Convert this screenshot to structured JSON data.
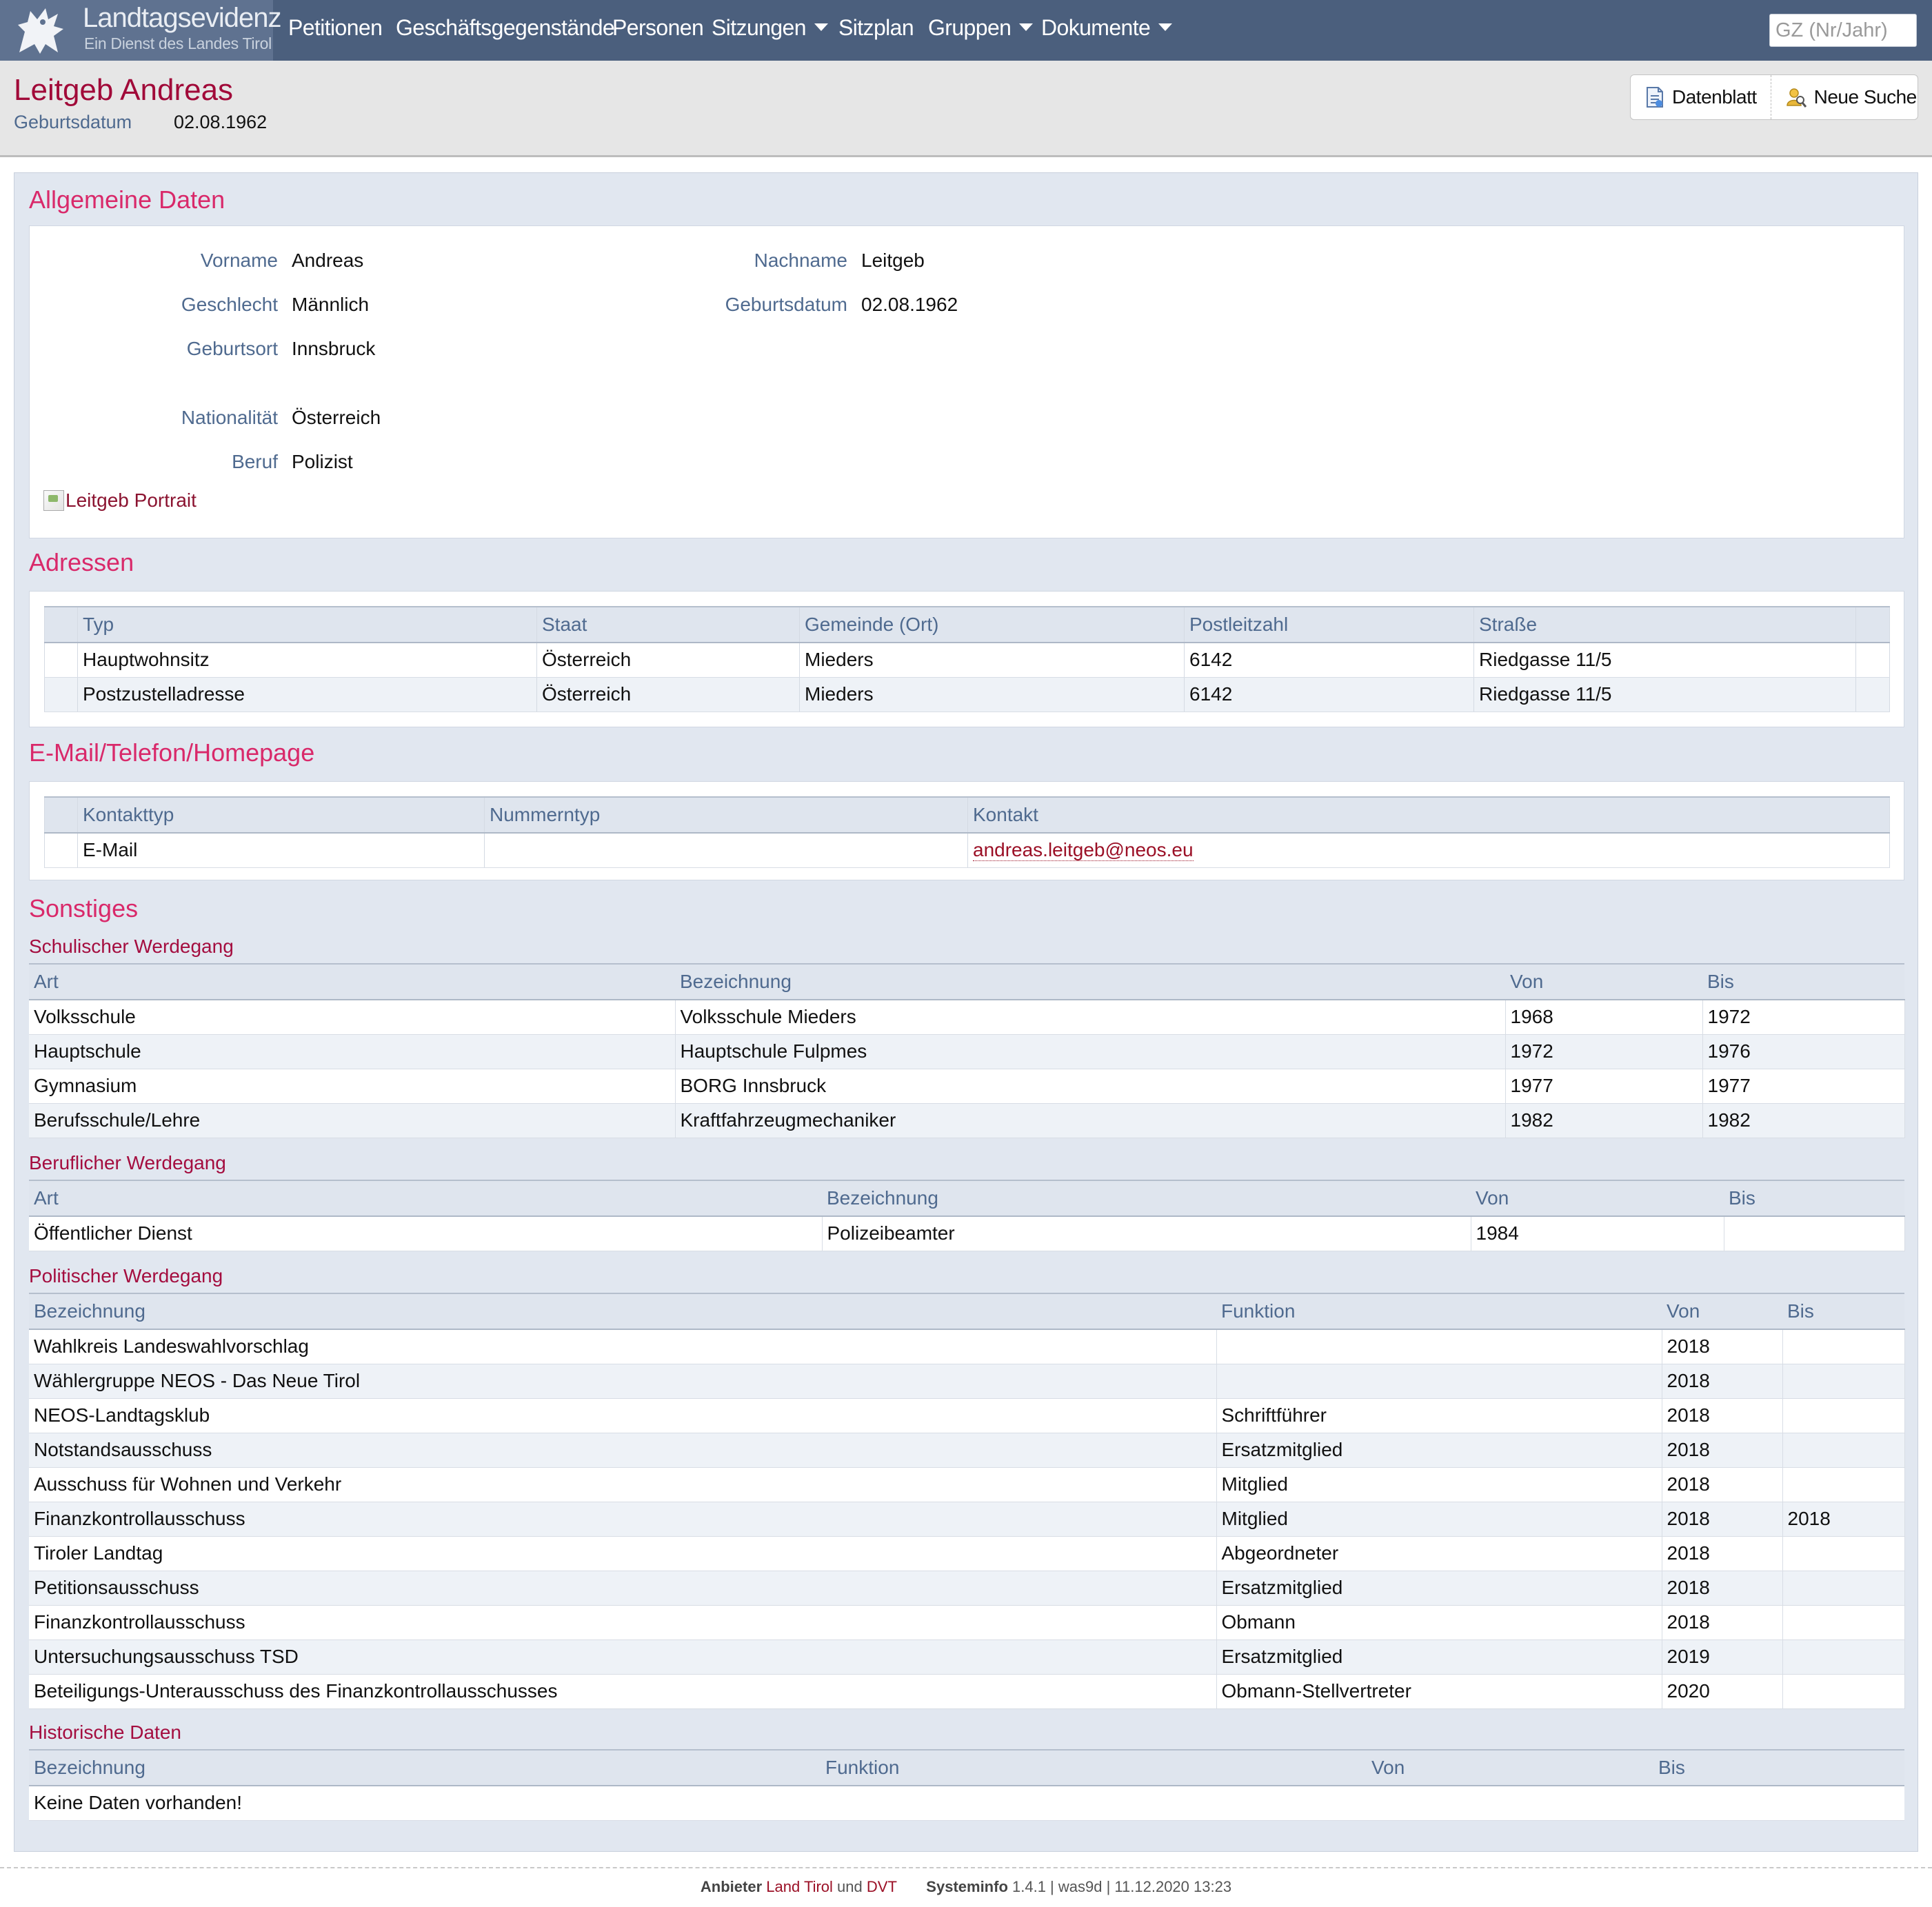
{
  "brand": {
    "title": "Landtagsevidenz",
    "subtitle": "Ein Dienst des Landes Tirol"
  },
  "nav": {
    "items": [
      {
        "label": "Petitionen",
        "dropdown": false
      },
      {
        "label": "Geschäftsgegenstände",
        "dropdown": false
      },
      {
        "label": "Personen",
        "dropdown": false
      },
      {
        "label": "Sitzungen",
        "dropdown": true
      },
      {
        "label": "Sitzplan",
        "dropdown": false
      },
      {
        "label": "Gruppen",
        "dropdown": true
      },
      {
        "label": "Dokumente",
        "dropdown": true
      }
    ],
    "search_placeholder": "GZ (Nr/Jahr)"
  },
  "header": {
    "name": "Leitgeb Andreas",
    "birth_label": "Geburtsdatum",
    "birth_value": "02.08.1962",
    "btn_datenblatt": "Datenblatt",
    "btn_neue_suche": "Neue Suche"
  },
  "allgemein": {
    "title": "Allgemeine Daten",
    "vorname_label": "Vorname",
    "vorname": "Andreas",
    "nachname_label": "Nachname",
    "nachname": "Leitgeb",
    "geschlecht_label": "Geschlecht",
    "geschlecht": "Männlich",
    "geburtsdatum_label": "Geburtsdatum",
    "geburtsdatum": "02.08.1962",
    "geburtsort_label": "Geburtsort",
    "geburtsort": "Innsbruck",
    "nationalitaet_label": "Nationalität",
    "nationalitaet": "Österreich",
    "beruf_label": "Beruf",
    "beruf": "Polizist",
    "portrait_alt": "Leitgeb Portrait"
  },
  "adressen": {
    "title": "Adressen",
    "headers": [
      "Typ",
      "Staat",
      "Gemeinde (Ort)",
      "Postleitzahl",
      "Straße"
    ],
    "rows": [
      [
        "Hauptwohnsitz",
        "Österreich",
        "Mieders",
        "6142",
        "Riedgasse 11/5"
      ],
      [
        "Postzustelladresse",
        "Österreich",
        "Mieders",
        "6142",
        "Riedgasse 11/5"
      ]
    ]
  },
  "kontakt": {
    "title": "E-Mail/Telefon/Homepage",
    "headers": [
      "Kontakttyp",
      "Nummerntyp",
      "Kontakt"
    ],
    "rows": [
      [
        "E-Mail",
        "",
        "andreas.leitgeb@neos.eu"
      ]
    ]
  },
  "sonstiges": {
    "title": "Sonstiges",
    "schulisch": {
      "title": "Schulischer Werdegang",
      "headers": [
        "Art",
        "Bezeichnung",
        "Von",
        "Bis"
      ],
      "rows": [
        [
          "Volksschule",
          "Volksschule Mieders",
          "1968",
          "1972"
        ],
        [
          "Hauptschule",
          "Hauptschule Fulpmes",
          "1972",
          "1976"
        ],
        [
          "Gymnasium",
          "BORG Innsbruck",
          "1977",
          "1977"
        ],
        [
          "Berufsschule/Lehre",
          "Kraftfahrzeugmechaniker",
          "1982",
          "1982"
        ]
      ]
    },
    "beruflich": {
      "title": "Beruflicher Werdegang",
      "headers": [
        "Art",
        "Bezeichnung",
        "Von",
        "Bis"
      ],
      "rows": [
        [
          "Öffentlicher Dienst",
          "Polizeibeamter",
          "1984",
          ""
        ]
      ]
    },
    "politisch": {
      "title": "Politischer Werdegang",
      "headers": [
        "Bezeichnung",
        "Funktion",
        "Von",
        "Bis"
      ],
      "rows": [
        [
          "Wahlkreis Landeswahlvorschlag",
          "",
          "2018",
          ""
        ],
        [
          "Wählergruppe NEOS - Das Neue Tirol",
          "",
          "2018",
          ""
        ],
        [
          "NEOS-Landtagsklub",
          "Schriftführer",
          "2018",
          ""
        ],
        [
          "Notstandsausschuss",
          "Ersatzmitglied",
          "2018",
          ""
        ],
        [
          "Ausschuss für Wohnen und Verkehr",
          "Mitglied",
          "2018",
          ""
        ],
        [
          "Finanzkontrollausschuss",
          "Mitglied",
          "2018",
          "2018"
        ],
        [
          "Tiroler Landtag",
          "Abgeordneter",
          "2018",
          ""
        ],
        [
          "Petitionsausschuss",
          "Ersatzmitglied",
          "2018",
          ""
        ],
        [
          "Finanzkontrollausschuss",
          "Obmann",
          "2018",
          ""
        ],
        [
          "Untersuchungsausschuss TSD",
          "Ersatzmitglied",
          "2019",
          ""
        ],
        [
          "Beteiligungs-Unterausschuss des Finanzkontrollausschusses",
          "Obmann-Stellvertreter",
          "2020",
          ""
        ]
      ]
    },
    "historisch": {
      "title": "Historische Daten",
      "headers": [
        "Bezeichnung",
        "Funktion",
        "Von",
        "Bis"
      ],
      "empty": "Keine Daten vorhanden!"
    }
  },
  "footer": {
    "anbieter_label": "Anbieter",
    "anbieter_1": "Land Tirol",
    "und": "und",
    "anbieter_2": "DVT",
    "systeminfo_label": "Systeminfo",
    "systeminfo_value": "1.4.1 | was9d | 11.12.2020 13:23"
  }
}
